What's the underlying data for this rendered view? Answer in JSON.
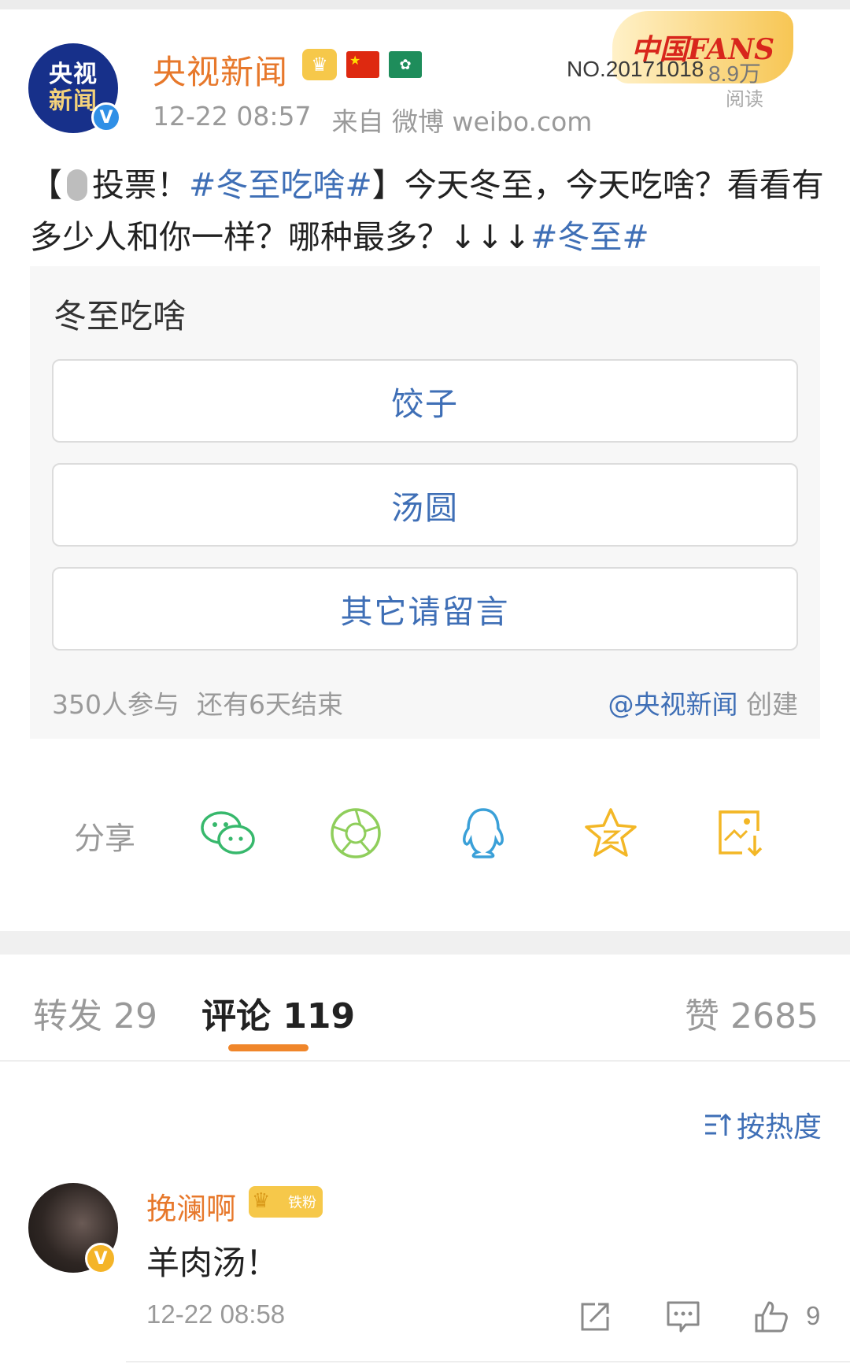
{
  "post": {
    "avatar_line1": "央视",
    "avatar_line2": "新闻",
    "verified_mark": "V",
    "author": "央视新闻",
    "time": "12-22 08:57",
    "source": "来自 微博 weibo.com",
    "fans_badge": {
      "logo": "中国FANS",
      "number": "NO.20171018",
      "reads": "8.9万",
      "reads_label": "阅读"
    },
    "text": {
      "open_bracket": "【",
      "vote_label": "投票！",
      "topic1": "#冬至吃啥#",
      "close_bracket": "】",
      "body": "今天冬至，今天吃啥？看看有多少人和你一样？哪种最多？↓↓↓",
      "topic2": "#冬至#"
    }
  },
  "poll": {
    "title": "冬至吃啥",
    "options": [
      "饺子",
      "汤圆",
      "其它请留言"
    ],
    "participants": "350人参与",
    "remaining": "还有6天结束",
    "creator": "@央视新闻",
    "created_label": "创建"
  },
  "share": {
    "label": "分享",
    "icons": [
      "wechat-icon",
      "moments-icon",
      "qq-icon",
      "qzone-icon",
      "save-image-icon"
    ]
  },
  "tabs": {
    "repost": "转发 29",
    "comments": "评论 119",
    "likes": "赞 2685"
  },
  "sort": {
    "label": "按热度"
  },
  "comment": {
    "name": "挽澜啊",
    "badge": "铁粉",
    "verified_mark": "V",
    "text": "羊肉汤！",
    "time": "12-22 08:58",
    "like_count": "9"
  },
  "colors": {
    "accent_orange": "#e7782b",
    "link_blue": "#3f6fb6",
    "tab_underline": "#f0862a"
  }
}
